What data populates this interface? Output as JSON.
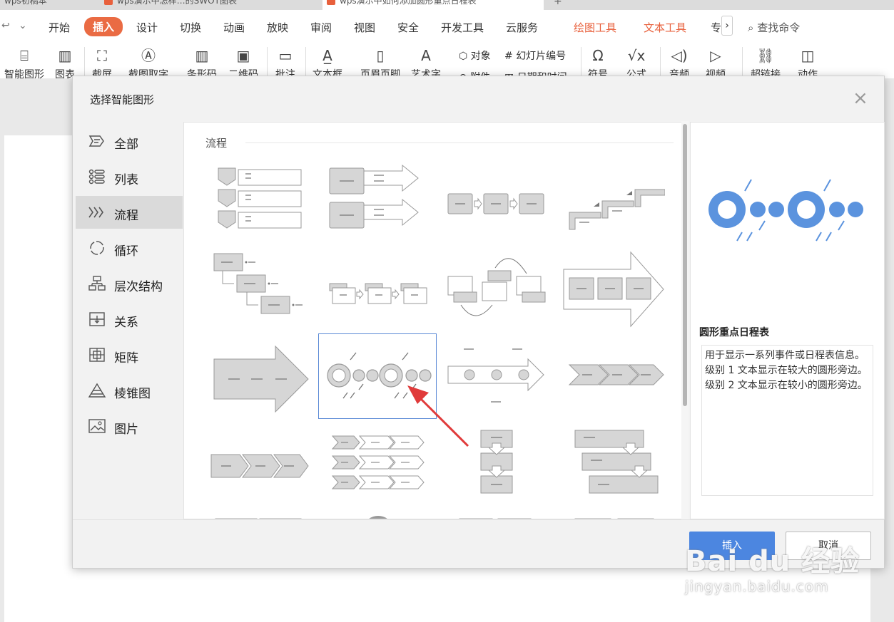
{
  "tabs": [
    {
      "label": "wps初稿本"
    },
    {
      "label": "wps演示中怎样…的SWOT图表"
    },
    {
      "label": "wps演示中如何添加圆形重点日程表"
    }
  ],
  "menu": {
    "items": [
      "开始",
      "插入",
      "设计",
      "切换",
      "动画",
      "放映",
      "审阅",
      "视图",
      "安全",
      "开发工具",
      "云服务"
    ],
    "active": "插入",
    "context_tabs": [
      "绘图工具",
      "文本工具"
    ],
    "overflow": "专",
    "more": "›",
    "search": "查找命令"
  },
  "ribbon": {
    "buttons": [
      "智能图形",
      "图表",
      "截屏",
      "截图取字",
      "条形码",
      "二维码",
      "批注",
      "文本框",
      "页眉页脚",
      "艺术字",
      "符号",
      "公式",
      "音频",
      "视频",
      "超链接",
      "动作"
    ],
    "small": [
      "对象",
      "幻灯片编号",
      "附件",
      "日期和时间"
    ]
  },
  "dialog": {
    "title": "选择智能图形",
    "close": "×",
    "categories": [
      {
        "label": "全部",
        "icon": "all-icon"
      },
      {
        "label": "列表",
        "icon": "list-icon"
      },
      {
        "label": "流程",
        "icon": "process-icon"
      },
      {
        "label": "循环",
        "icon": "cycle-icon"
      },
      {
        "label": "层次结构",
        "icon": "hierarchy-icon"
      },
      {
        "label": "关系",
        "icon": "relationship-icon"
      },
      {
        "label": "矩阵",
        "icon": "matrix-icon"
      },
      {
        "label": "棱锥图",
        "icon": "pyramid-icon"
      },
      {
        "label": "图片",
        "icon": "picture-icon"
      }
    ],
    "selected_category": "流程",
    "section_title": "流程",
    "preview": {
      "name": "圆形重点日程表",
      "description": "用于显示一系列事件或日程表信息。级别 1 文本显示在较大的圆形旁边。级别 2 文本显示在较小的圆形旁边。"
    },
    "insert_label": "插入",
    "cancel_label": "取消"
  },
  "watermark": {
    "brand": "Bai du 经验",
    "url": "jingyan.baidu.com"
  },
  "colors": {
    "accent": "#ea6b43",
    "primary_button": "#4c86e0",
    "preview_circles": "#5b93de",
    "thumb_gray": "#d6d6d6",
    "annotation_arrow": "#e03a3a"
  }
}
